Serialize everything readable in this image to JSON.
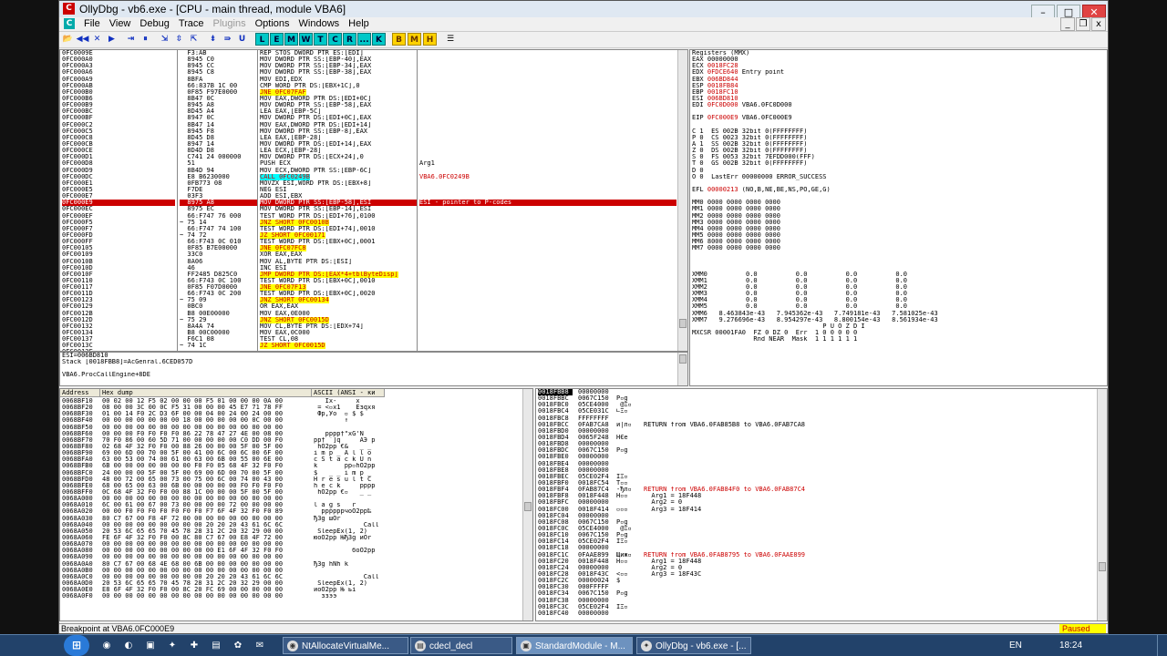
{
  "window": {
    "title": "OllyDbg - vb6.exe - [CPU - main thread, module VBA6]",
    "app_icon_label": "C",
    "mdi_icon_label": "C",
    "min_glyph": "–",
    "max_glyph": "□",
    "close_glyph": "✕",
    "mdi_min_glyph": "_",
    "mdi_restore_glyph": "❐",
    "mdi_close_glyph": "x"
  },
  "menu": [
    {
      "label": "File",
      "enabled": true
    },
    {
      "label": "View",
      "enabled": true
    },
    {
      "label": "Debug",
      "enabled": true
    },
    {
      "label": "Trace",
      "enabled": true
    },
    {
      "label": "Plugins",
      "enabled": false
    },
    {
      "label": "Options",
      "enabled": true
    },
    {
      "label": "Windows",
      "enabled": true
    },
    {
      "label": "Help",
      "enabled": true
    }
  ],
  "toolbar": {
    "nav_buttons": [
      "📂",
      "◀◀",
      "✕",
      "▶",
      "⇥",
      "⏸",
      "⇲",
      "⇳",
      "⇱",
      "⇟",
      "⇛",
      "U"
    ],
    "window_buttons": [
      "L",
      "E",
      "M",
      "W",
      "T",
      "C",
      "R",
      "...",
      "K"
    ],
    "bookmark_buttons": [
      "B",
      "M",
      "H"
    ],
    "list_button": "☰"
  },
  "disasm": {
    "addresses": [
      "0FC0009E",
      "0FC000A0",
      "0FC000A3",
      "0FC000A6",
      "0FC000A9",
      "0FC000AB",
      "0FC000B0",
      "0FC000B6",
      "0FC000B9",
      "0FC000BC",
      "0FC000BF",
      "0FC000C2",
      "0FC000C5",
      "0FC000C8",
      "0FC000CB",
      "0FC000CE",
      "0FC000D1",
      "0FC000D8",
      "0FC000D9",
      "0FC000DC",
      "0FC000E1",
      "0FC000E5",
      "0FC000E7",
      "0FC000E9",
      "0FC000EC",
      "0FC000EF",
      "0FC000F5",
      "0FC000F7",
      "0FC000FD",
      "0FC000FF",
      "0FC00105",
      "0FC00109",
      "0FC0010B",
      "0FC0010D",
      "0FC0010F",
      "0FC00110",
      "0FC00117",
      "0FC0011D",
      "0FC00123",
      "0FC00129",
      "0FC0012B",
      "0FC0012D",
      "0FC00132",
      "0FC00134",
      "0FC00137",
      "0FC0013C",
      "0FC0013F"
    ],
    "hex": [
      "F3:AB",
      "8945 C0",
      "8945 CC",
      "8945 C8",
      "8BFA",
      "66:837B 1C 00",
      "0F85 F97E0000",
      "8B47 0C",
      "8945 A8",
      "8D45 A4",
      "8947 0C",
      "8B47 14",
      "8945 F8",
      "8D45 D8",
      "8947 14",
      "8D4D D8",
      "C741 24 000000",
      "51",
      "8B4D 94",
      "E8 B6230000",
      "0FB773 08",
      "F7DE",
      "03F3",
      "8975 A8",
      "8975 EC",
      "66:F747 76 000",
      "75 14",
      "66:F747 74 100",
      "74 72",
      "66:F743 0C 010",
      "0F85 B7E00000",
      "33C0",
      "8A06",
      "46",
      "FF2485 D825C0",
      "66:F743 0C 100",
      "0F85 F07D0000",
      "66:F743 0C 200",
      "75 09",
      "0BC0",
      "B8 00E00000",
      "75 29",
      "8A4A 74",
      "B8 00C00000",
      "F6C1 08",
      "74 1C",
      ""
    ],
    "prefix": [
      "",
      "",
      "",
      "",
      "",
      "",
      "",
      "",
      "",
      "",
      "",
      "",
      "",
      "",
      "",
      "",
      "",
      "",
      "",
      "",
      "",
      "",
      "",
      "",
      "",
      "",
      "~",
      "",
      "~",
      "",
      "",
      "",
      "",
      "",
      "",
      "",
      "",
      "",
      "~",
      "",
      "",
      "~",
      "",
      "",
      "",
      "~",
      ""
    ],
    "asm": [
      "REP STOS DWORD PTR ES:[EDI]",
      "MOV DWORD PTR SS:[EBP-40],EAX",
      "MOV DWORD PTR SS:[EBP-34],EAX",
      "MOV DWORD PTR SS:[EBP-38],EAX",
      "MOV EDI,EDX",
      "CMP WORD PTR DS:[EBX+1C],0",
      "JNE 0FC07FAF",
      "MOV EAX,DWORD PTR DS:[EDI+0C]",
      "MOV DWORD PTR SS:[EBP-58],EAX",
      "LEA EAX,[EBP-5C]",
      "MOV DWORD PTR DS:[EDI+0C],EAX",
      "MOV EAX,DWORD PTR DS:[EDI+14]",
      "MOV DWORD PTR SS:[EBP-8],EAX",
      "LEA EAX,[EBP-28]",
      "MOV DWORD PTR DS:[EDI+14],EAX",
      "LEA ECX,[EBP-28]",
      "MOV DWORD PTR DS:[ECX+24],0",
      "PUSH ECX",
      "MOV ECX,DWORD PTR SS:[EBP-6C]",
      "CALL 0FC0249B",
      "MOVZX ESI,WORD PTR DS:[EBX+8]",
      "NEG ESI",
      "ADD ESI,EBX",
      "MOV DWORD PTR SS:[EBP-58],ESI",
      "MOV DWORD PTR SS:[EBP-14],ESI",
      "TEST WORD PTR DS:[EDI+76],0100",
      "JNZ SHORT 0FC0010B",
      "TEST WORD PTR DS:[EDI+74],0010",
      "JZ SHORT 0FC00171",
      "TEST WORD PTR DS:[EBX+0C],0001",
      "JNE 0FC07FC8",
      "XOR EAX,EAX",
      "MOV AL,BYTE PTR DS:[ESI]",
      "INC ESI",
      "JMP DWORD PTR DS:[EAX*4+tblByteDisp]",
      "TEST WORD PTR DS:[EBX+0C],0010",
      "JNE 0FC07F13",
      "TEST WORD PTR DS:[EBX+0C],0020",
      "JNZ SHORT 0FC00134",
      "OR EAX,EAX",
      "MOV EAX,0E000",
      "JNZ SHORT 0FC0015D",
      "MOV CL,BYTE PTR DS:[EDX+74]",
      "MOV EAX,0C000",
      "TEST CL,08",
      "JZ SHORT 0FC0015D",
      ""
    ],
    "comments": {
      "17": "Arg1",
      "19": "VBA6.0FC0249B",
      "23": "ESI - pointer to P-codes"
    },
    "highlight_rows": [
      6,
      19,
      26,
      28,
      30,
      34,
      36,
      38,
      41,
      45
    ],
    "selected_row": 23,
    "info_lines": [
      "ESI=006BD810",
      "Stack [0018FBB8]=AcGenral.6CED057D",
      "",
      "VBA6.ProcCallEngine+8DE"
    ]
  },
  "registers": {
    "header": "Registers (MMX)",
    "lines": [
      "EAX 00000000",
      "ECX 0018FC28",
      "EDX 0FDCE640 Entry point",
      "EBX 006BD844",
      "ESP 0018FB84",
      "EBP 0018FC10",
      "ESI 006BD810",
      "EDI 0FC0D000 VBA6.0FC0D000",
      "",
      "EIP 0FC000E9 VBA6.0FC000E9",
      "",
      "C 1  ES 002B 32bit 0(FFFFFFFF)",
      "P 0  CS 0023 32bit 0(FFFFFFFF)",
      "A 1  SS 002B 32bit 0(FFFFFFFF)",
      "Z 0  DS 002B 32bit 0(FFFFFFFF)",
      "S 0  FS 0053 32bit 7EFDD000(FFF)",
      "T 0  GS 002B 32bit 0(FFFFFFFF)",
      "D 0",
      "O 0  LastErr 00000000 ERROR_SUCCESS",
      "",
      "EFL 00000213 (NO,B,NE,BE,NS,PO,GE,G)",
      "",
      "MM0 0000 0000 0000 0000",
      "MM1 0000 0000 0000 0000",
      "MM2 0000 0000 0000 0000",
      "MM3 0000 0000 0000 0000",
      "MM4 0000 0000 0000 0000",
      "MM5 0000 0000 0000 0000",
      "MM6 8000 0000 0000 0000",
      "MM7 0000 0000 0000 0000",
      "",
      "",
      "",
      "XMM0          0.0          0.0          0.0          0.0",
      "XMM1          0.0          0.0          0.0          0.0",
      "XMM2          0.0          0.0          0.0          0.0",
      "XMM3          0.0          0.0          0.0          0.0",
      "XMM4          0.0          0.0          0.0          0.0",
      "XMM5          0.0          0.0          0.0          0.0",
      "XMM6   8.463843e-43   7.945362e-43   7.749181e-43   7.581025e-43",
      "XMM7   9.276696e-43   8.954297e-43   8.800154e-43   8.561934e-43",
      "                                  P U O Z D I",
      "MXCSR 00001FA0  FZ 0 DZ 0  Err  1 0 0 0 0 0",
      "                Rnd NEAR  Mask  1 1 1 1 1 1"
    ],
    "red_rows": [
      1,
      2,
      3,
      4,
      5,
      6,
      7,
      9,
      20
    ]
  },
  "dump": {
    "col_address": "Address",
    "col_hex": "Hex dump",
    "col_ascii": "ASCII (ANSI - ки",
    "rows": [
      [
        "0068BF10",
        "00 02 00 12 F5 02 00 00 00 F5 01 00 00 00 0A 00",
        "   Ix-     x    "
      ],
      [
        "0068BF20",
        "08 00 00 3C 00 0C F5 31 00 00 00 45 E7 71 78 FF",
        " = <▫x1    Eзqxя"
      ],
      [
        "0068BF30",
        "01 00 14 F0 2C D3 6F 00 00 04 00 24 00 24 00 00",
        " Фр,Уo  ▫ $ $  "
      ],
      [
        "0068BF40",
        "00 00 00 00 00 00 00 18 00 00 00 00 00 0C 00 00",
        "        ↑       "
      ],
      [
        "0068BF50",
        "00 00 00 00 00 00 00 00 00 00 00 00 00 00 00 00",
        "                "
      ],
      [
        "0068BF60",
        "00 00 00 F0 F0 F0 F0 86 22 78 47 27 4E 00 08 00",
        "   рррр†\"xG'N  "
      ],
      [
        "0068BF70",
        "70 F0 86 00 60 5D 71 00 00 00 00 00 C0 DD 00 F0",
        "pр† `]q     АЭ р"
      ],
      [
        "0068BF80",
        "02 68 4F 32 F0 F0 00 88 26 00 00 00 5F 00 5F 00",
        " hO2pp €&   _ _ "
      ],
      [
        "0068BF90",
        "69 00 6D 00 70 00 5F 00 41 00 6C 00 6C 00 6F 00",
        "i m p _ A l l o "
      ],
      [
        "0068BFA0",
        "63 00 53 00 74 00 61 00 63 00 6B 00 55 00 6E 00",
        "c S t a c k U n "
      ],
      [
        "0068BFB0",
        "6B 00 00 00 00 00 00 00 F0 F0 05 68 4F 32 F0 F0",
        "k       pp▫hO2pp"
      ],
      [
        "0068BFC0",
        "24 00 00 00 5F 00 5F 00 69 00 6D 00 70 00 5F 00",
        "$   _ _ i m p _ "
      ],
      [
        "0068BFD0",
        "48 00 72 00 65 00 73 00 75 00 6C 00 74 00 43 00",
        "H r e s u l t C "
      ],
      [
        "0068BFE0",
        "68 00 65 00 63 00 6B 00 00 00 00 00 F0 F0 F0 F0",
        "h e c k     pppp"
      ],
      [
        "0068BFF0",
        "0C 68 4F 32 F0 F0 00 88 1C 00 00 00 5F 00 5F 00",
        " hO2pp €▫   _ _ "
      ],
      [
        "0068A000",
        "00 00 00 00 00 00 00 00 00 00 00 00 00 00 00 00",
        "                "
      ],
      [
        "0068A010",
        "6C 00 61 00 67 00 73 00 00 00 00 72 00 00 00 00",
        "l a g s   r     "
      ],
      [
        "0068A020",
        "00 00 F0 F0 F0 F0 F0 F0 F0 F7 6F 4F 32 F0 F0 89",
        "  ppppppчoO2pp‰"
      ],
      [
        "0068A030",
        "80 C7 67 00 F8 4F 72 00 00 00 00 00 00 00 00 00",
        "ЂЗg шOr         "
      ],
      [
        "0068A040",
        "00 00 00 00 00 00 00 00 00 20 20 20 43 61 6C 6C",
        "             Call"
      ],
      [
        "0068A050",
        "20 53 6C 65 65 70 45 78 28 31 2C 20 32 29 00 00",
        " SleepEx(1, 2)  "
      ],
      [
        "0068A060",
        "FE 6F 4F 32 F0 F0 00 8C 80 C7 67 00 E8 4F 72 00",
        "юoO2pp ЊЂЗg иOr "
      ],
      [
        "0068A070",
        "00 00 00 00 00 00 00 00 00 00 00 00 00 00 00 00",
        "                "
      ],
      [
        "0068A080",
        "00 00 00 00 00 00 00 00 00 00 E1 6F 4F 32 F0 F0",
        "          бoO2pp"
      ],
      [
        "0068A090",
        "00 00 00 00 00 00 00 00 00 00 00 00 00 00 00 00",
        "                "
      ],
      [
        "0068A0A0",
        "80 C7 67 00 68 4E 68 00 6B 00 00 00 00 00 00 00",
        "ЂЗg hNh k       "
      ],
      [
        "0068A0B0",
        "00 00 00 00 00 00 00 00 00 00 00 00 00 00 00 00",
        "                "
      ],
      [
        "0068A0C0",
        "00 00 00 00 00 00 00 00 00 20 20 20 43 61 6C 6C",
        "             Call"
      ],
      [
        "0068A0D0",
        "20 53 6C 65 65 70 45 78 28 31 2C 20 32 29 00 00",
        " SleepEx(1, 2)  "
      ],
      [
        "0068A0E0",
        "E8 6F 4F 32 F0 F0 00 8C 20 FC 69 00 00 00 00 00",
        "иoO2pp Њ ьi     "
      ],
      [
        "0068A0F0",
        "00 00 00 00 00 00 00 00 00 00 00 00 00 00 00 00",
        "  ззээ          "
      ]
    ]
  },
  "stack": {
    "rows": [
      [
        "0018FBB8",
        "00000000",
        "",
        " "
      ],
      [
        "0018FBBC",
        "0067C150",
        "P▫g",
        ""
      ],
      [
        "0018FBC0",
        "05CE4000",
        " @Ξ▫",
        ""
      ],
      [
        "0018FBC4",
        "05CE031C",
        "∟Ξ▫",
        ""
      ],
      [
        "0018FBC8",
        "FFFFFFFF",
        "",
        ""
      ],
      [
        "0018FBCC",
        "0FAB7CA8",
        "и|л▫",
        "RETURN from VBA6.0FAB85B8 to VBA6.0FAB7CA8"
      ],
      [
        "0018FBD0",
        "00000000",
        "",
        ""
      ],
      [
        "0018FBD4",
        "0065F248",
        "HЄe",
        ""
      ],
      [
        "0018FBD8",
        "00000000",
        "",
        ""
      ],
      [
        "0018FBDC",
        "0067C150",
        "P▫g",
        ""
      ],
      [
        "0018FBE0",
        "00000000",
        "",
        ""
      ],
      [
        "0018FBE4",
        "00000000",
        "",
        ""
      ],
      [
        "0018FBE8",
        "00000000",
        "",
        ""
      ],
      [
        "0018FBEC",
        "05CE02F4",
        "ЇΞ▫",
        ""
      ],
      [
        "0018FBF0",
        "0018FC54",
        "T▫▫",
        ""
      ],
      [
        "0018FBF4",
        "0FAB87C4",
        "-Ђл▫",
        "RETURN from VBA6.0FAB84F0 to VBA6.0FAB87C4"
      ],
      [
        "0018FBF8",
        "0018F448",
        "H▫▫",
        "  Arg1 = 18F448"
      ],
      [
        "0018FBFC",
        "00000000",
        "",
        "  Arg2 = 0"
      ],
      [
        "0018FC00",
        "0018F414",
        "▫▫▫",
        "  Arg3 = 18F414"
      ],
      [
        "0018FC04",
        "00000000",
        "",
        ""
      ],
      [
        "0018FC08",
        "0067C150",
        "P▫g",
        ""
      ],
      [
        "0018FC0C",
        "05CE4000",
        " @Ξ▫",
        ""
      ],
      [
        "0018FC10",
        "0067C150",
        "P▫g",
        ""
      ],
      [
        "0018FC14",
        "05CE02F4",
        "ЇΞ▫",
        ""
      ],
      [
        "0018FC18",
        "00000000",
        "",
        ""
      ],
      [
        "0018FC1C",
        "0FAAE899",
        "Щиж▫",
        "RETURN from VBA6.0FAB8795 to VBA6.0FAAE899"
      ],
      [
        "0018FC20",
        "0018F448",
        "H▫▫",
        "  Arg1 = 18F448"
      ],
      [
        "0018FC24",
        "00000000",
        "",
        "  Arg2 = 0"
      ],
      [
        "0018FC28",
        "0018F43C",
        "<▫▫",
        "  Arg3 = 18F43C"
      ],
      [
        "0018FC2C",
        "00000024",
        "$",
        ""
      ],
      [
        "0018FC30",
        "000FFFFF",
        "",
        ""
      ],
      [
        "0018FC34",
        "0067C150",
        "P▫g",
        ""
      ],
      [
        "0018FC38",
        "00000000",
        "",
        ""
      ],
      [
        "0018FC3C",
        "05CE02F4",
        "ЇΞ▫",
        ""
      ],
      [
        "0018FC40",
        "00000000",
        "",
        ""
      ]
    ],
    "red_rows": [
      15,
      25
    ]
  },
  "status": {
    "message": "Breakpoint at VBA6.0FC000E9",
    "state": "Paused"
  },
  "taskbar": {
    "start_glyph": "⊞",
    "quick_icons": [
      "◉",
      "◐",
      "▣",
      "✦",
      "✚",
      "▤",
      "✿",
      "✉"
    ],
    "tasks": [
      {
        "label": "NtAllocateVirtualMe...",
        "icon": "◉",
        "active": false
      },
      {
        "label": "cdecl_decl",
        "icon": "▤",
        "active": false
      },
      {
        "label": "StandardModule - M...",
        "icon": "▣",
        "active": true
      },
      {
        "label": "OllyDbg - vb6.exe - [...",
        "icon": "✦",
        "active": false
      }
    ],
    "language": "EN",
    "clock": "18:24"
  },
  "colors": {
    "highlight_bg": "#ffff00",
    "highlight_fg": "#c00000",
    "selection_bg": "#000000",
    "accent_red": "#c00000"
  }
}
